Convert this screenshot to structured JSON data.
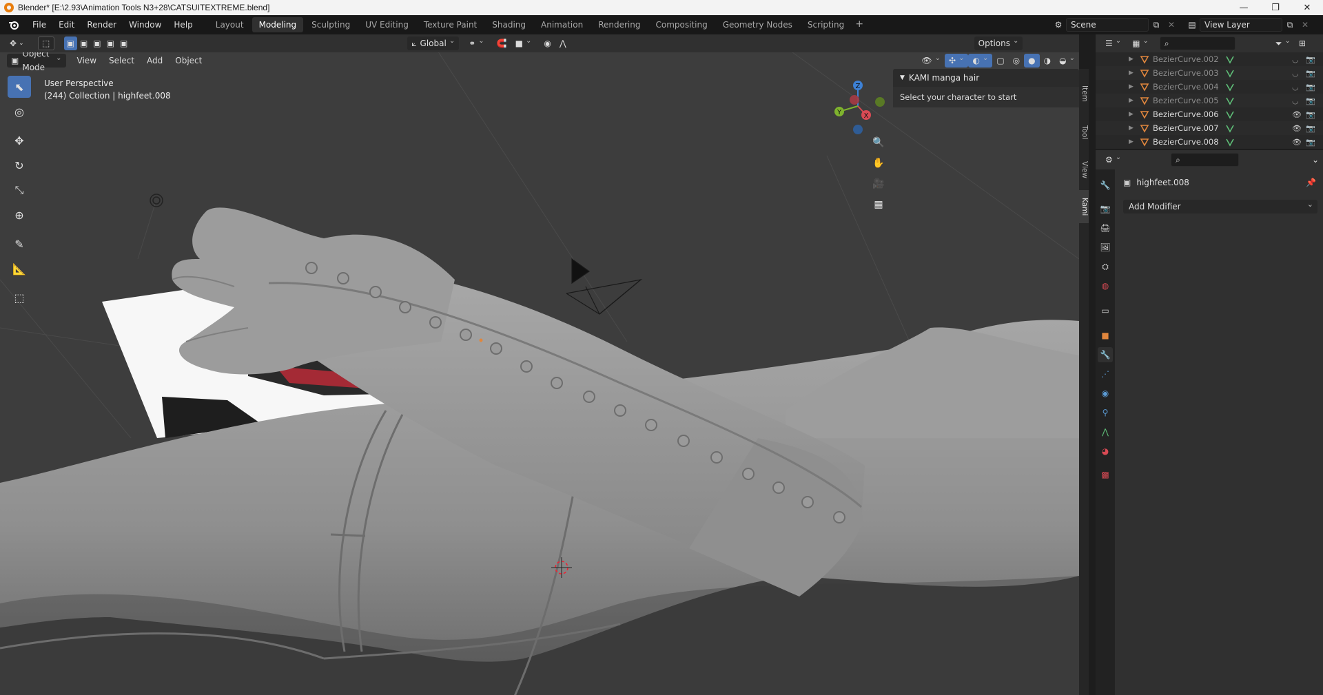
{
  "window": {
    "title": "Blender* [E:\\2.93\\Animation Tools N3+28\\CATSUITEXTREME.blend]",
    "minimize": "—",
    "restore": "❐",
    "close": "✕"
  },
  "menu": [
    "File",
    "Edit",
    "Render",
    "Window",
    "Help"
  ],
  "workspaces": [
    "Layout",
    "Modeling",
    "Sculpting",
    "UV Editing",
    "Texture Paint",
    "Shading",
    "Animation",
    "Rendering",
    "Compositing",
    "Geometry Nodes",
    "Scripting"
  ],
  "active_workspace": "Modeling",
  "scene": {
    "name": "Scene",
    "view_layer": "View Layer"
  },
  "viewport": {
    "mode": "Object Mode",
    "menus": [
      "View",
      "Select",
      "Add",
      "Object"
    ],
    "transform_orientation": "Global",
    "options": "Options",
    "info_line1": "User Perspective",
    "info_line2": "(244) Collection | highfeet.008",
    "gizmo_labels": {
      "z": "Z",
      "y": "Y",
      "x": "X"
    }
  },
  "npanel": {
    "panel_title": "KAMI manga hair",
    "panel_text": "Select your character to start",
    "tabs": [
      "Item",
      "Tool",
      "View",
      "Kami"
    ],
    "active_tab": "Kami"
  },
  "outliner": {
    "rows": [
      {
        "name": "BezierCurve.002",
        "visible": false
      },
      {
        "name": "BezierCurve.003",
        "visible": false
      },
      {
        "name": "BezierCurve.004",
        "visible": false
      },
      {
        "name": "BezierCurve.005",
        "visible": false
      },
      {
        "name": "BezierCurve.006",
        "visible": true
      },
      {
        "name": "BezierCurve.007",
        "visible": true
      },
      {
        "name": "BezierCurve.008",
        "visible": true
      }
    ]
  },
  "properties": {
    "object_name": "highfeet.008",
    "add_modifier": "Add Modifier"
  },
  "colors": {
    "accent": "#4772b3",
    "curve_orange": "#e0863d",
    "modifier_green": "#5fbf78",
    "axis_x": "#d94a54",
    "axis_y": "#7fb32e",
    "axis_z": "#3d81d6"
  }
}
